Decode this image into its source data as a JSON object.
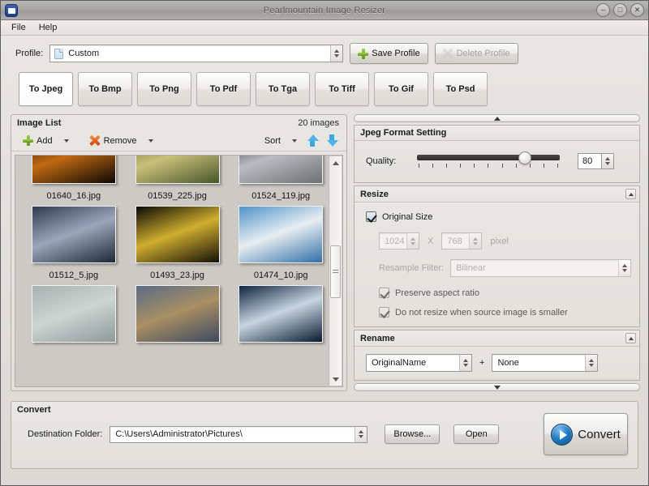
{
  "window": {
    "title": "Pearlmountain Image Resizer",
    "app_icon": "app-icon",
    "minimize": "–",
    "maximize": "□",
    "close": "✕"
  },
  "menubar": {
    "items": [
      {
        "label": "File"
      },
      {
        "label": "Help"
      }
    ]
  },
  "profile": {
    "label": "Profile:",
    "value": "Custom",
    "save_label": "Save Profile",
    "delete_label": "Delete Profile",
    "delete_disabled": true
  },
  "format_tabs": {
    "active": "To Jpeg",
    "items": [
      {
        "label": "To Jpeg"
      },
      {
        "label": "To Bmp"
      },
      {
        "label": "To Png"
      },
      {
        "label": "To Pdf"
      },
      {
        "label": "To Tga"
      },
      {
        "label": "To Tiff"
      },
      {
        "label": "To Gif"
      },
      {
        "label": "To Psd"
      }
    ]
  },
  "image_list": {
    "title": "Image List",
    "count_label": "20 images",
    "toolbar": {
      "add_label": "Add",
      "remove_label": "Remove",
      "sort_label": "Sort",
      "move_up": "move-up-arrow",
      "move_down": "move-down-arrow"
    },
    "rows": [
      [
        {
          "name": "01640_16.jpg",
          "c1": "#1a0c04",
          "c2": "#c06a12",
          "c3": "#0d0703"
        },
        {
          "name": "01539_225.jpg",
          "c1": "#5a6b2a",
          "c2": "#c9c07a",
          "c3": "#47562a"
        },
        {
          "name": "01524_119.jpg",
          "c1": "#2b2a28",
          "c2": "#b9bdc2",
          "c3": "#6d6f70"
        }
      ],
      [
        {
          "name": "01512_5.jpg",
          "c1": "#2e3a52",
          "c2": "#9aa7bb",
          "c3": "#1d2738"
        },
        {
          "name": "01493_23.jpg",
          "c1": "#0a0905",
          "c2": "#cfae2e",
          "c3": "#141008"
        },
        {
          "name": "01474_10.jpg",
          "c1": "#4f93c9",
          "c2": "#e8eef2",
          "c3": "#2f6fa6"
        }
      ],
      [
        {
          "name": "",
          "c1": "#a8b2b0",
          "c2": "#cdd5d3",
          "c3": "#8e9997"
        },
        {
          "name": "",
          "c1": "#5a6b86",
          "c2": "#a98f63",
          "c3": "#3c4a60"
        },
        {
          "name": "",
          "c1": "#0e2440",
          "c2": "#c7d5e2",
          "c3": "#0a1a2f"
        }
      ]
    ]
  },
  "settings": {
    "collapse_up": "collapse-up",
    "collapse_down": "collapse-down",
    "jpeg": {
      "title": "Jpeg Format Setting",
      "quality_label": "Quality:",
      "quality_value": "80",
      "quality_min": 0,
      "quality_max": 100,
      "tick_count": 11
    },
    "resize": {
      "title": "Resize",
      "original_size_label": "Original Size",
      "original_size_checked": true,
      "width": "1024",
      "x_label": "X",
      "height": "768",
      "pixel_label": "pixel",
      "resample_label": "Resample Filter:",
      "resample_value": "Bilinear",
      "preserve_label": "Preserve aspect ratio",
      "preserve_checked": true,
      "no_upscale_label": "Do not resize when source image is smaller",
      "no_upscale_checked": true
    },
    "rename": {
      "title": "Rename",
      "first_value": "OriginalName",
      "plus_label": "+",
      "second_value": "None"
    }
  },
  "convert": {
    "title": "Convert",
    "dest_label": "Destination Folder:",
    "dest_value": "C:\\Users\\Administrator\\Pictures\\",
    "browse_label": "Browse...",
    "open_label": "Open",
    "convert_label": "Convert"
  }
}
